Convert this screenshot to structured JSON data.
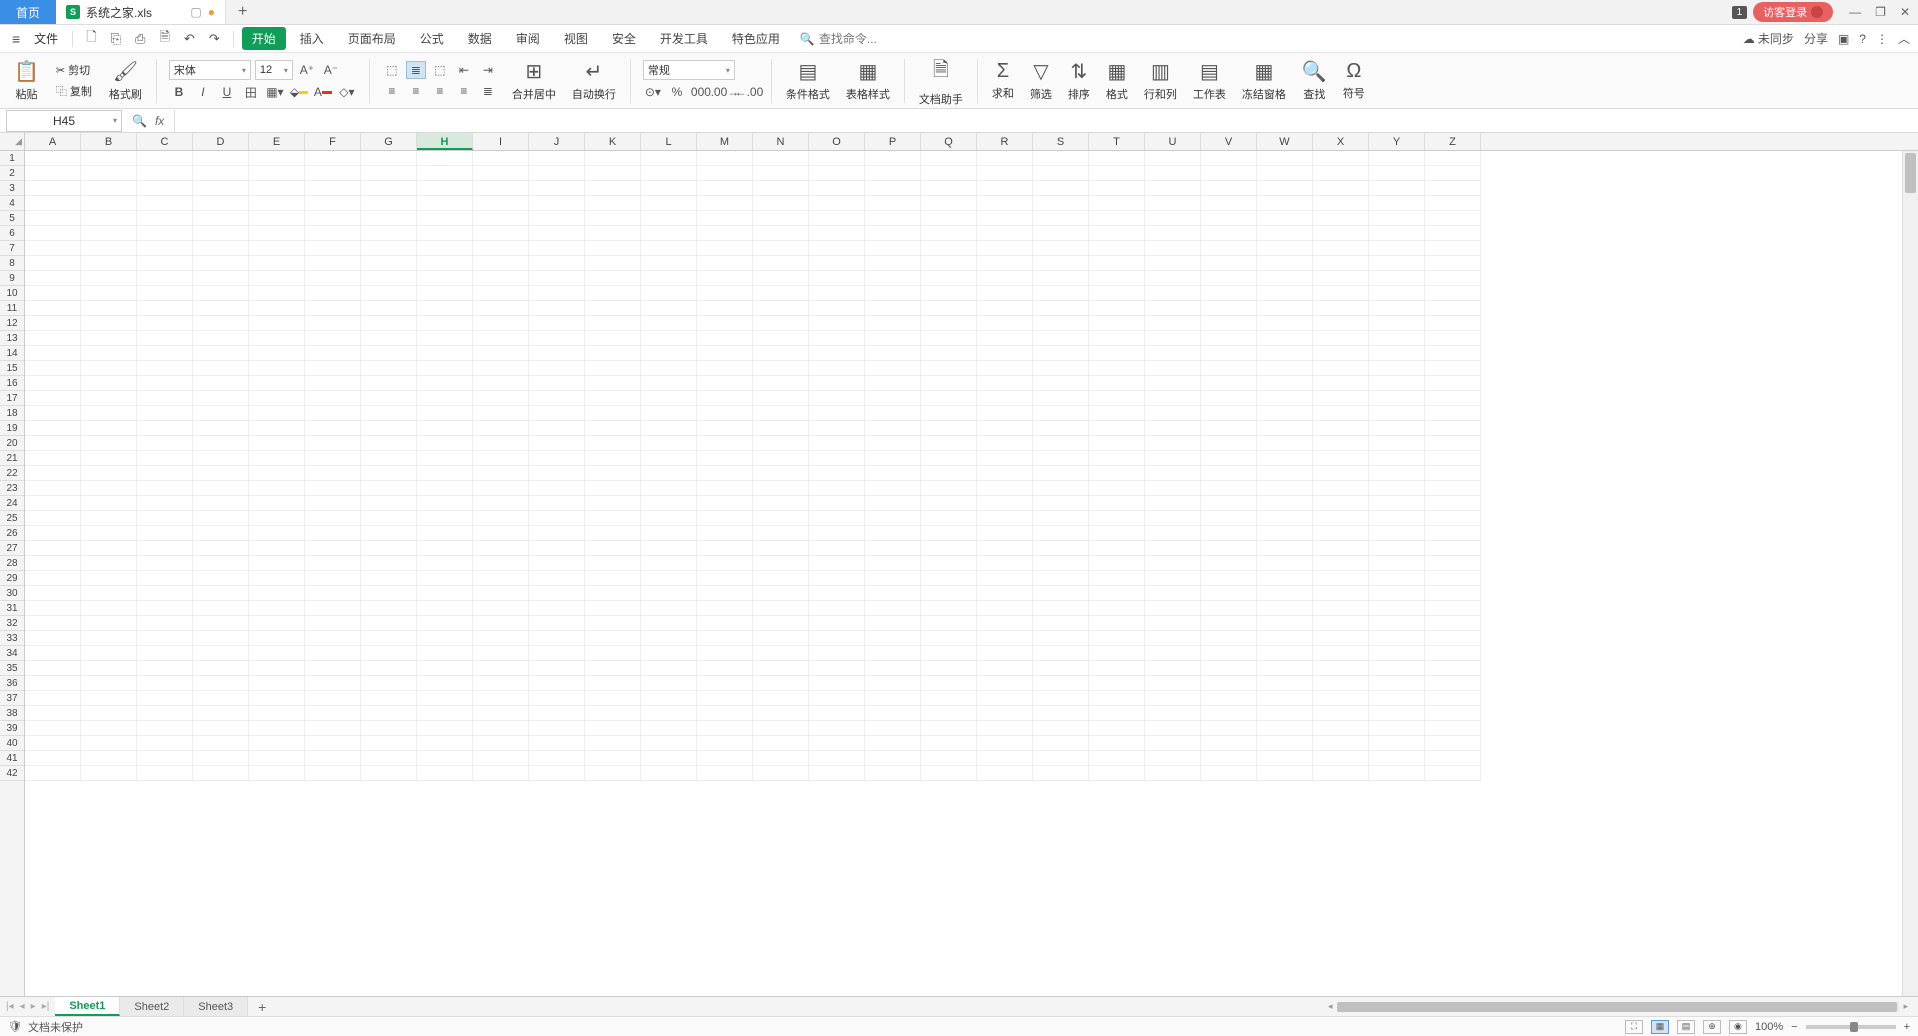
{
  "titlebar": {
    "home_tab": "首页",
    "doc_name": "系统之家.xls",
    "badge": "1",
    "login": "访客登录"
  },
  "menubar": {
    "file": "文件",
    "tabs": [
      "开始",
      "插入",
      "页面布局",
      "公式",
      "数据",
      "审阅",
      "视图",
      "安全",
      "开发工具",
      "特色应用"
    ],
    "search_placeholder": "查找命令...",
    "unsync": "未同步",
    "share": "分享"
  },
  "ribbon": {
    "paste": "粘贴",
    "cut": "剪切",
    "copy": "复制",
    "format_painter": "格式刷",
    "font_name": "宋体",
    "font_size": "12",
    "merge_center": "合并居中",
    "wrap_text": "自动换行",
    "number_format": "常规",
    "cond_fmt": "条件格式",
    "table_style": "表格样式",
    "doc_assist": "文档助手",
    "sum": "求和",
    "filter": "筛选",
    "sort": "排序",
    "format": "格式",
    "row_col": "行和列",
    "worksheet": "工作表",
    "freeze": "冻结窗格",
    "find": "查找",
    "symbol": "符号"
  },
  "namebox": "H45",
  "columns": [
    "A",
    "B",
    "C",
    "D",
    "E",
    "F",
    "G",
    "H",
    "I",
    "J",
    "K",
    "L",
    "M",
    "N",
    "O",
    "P",
    "Q",
    "R",
    "S",
    "T",
    "U",
    "V",
    "W",
    "X",
    "Y",
    "Z"
  ],
  "rows_count": 42,
  "active_col": "H",
  "sheets": [
    "Sheet1",
    "Sheet2",
    "Sheet3"
  ],
  "active_sheet": "Sheet1",
  "statusbar": {
    "protect": "文档未保护",
    "zoom": "100%"
  }
}
